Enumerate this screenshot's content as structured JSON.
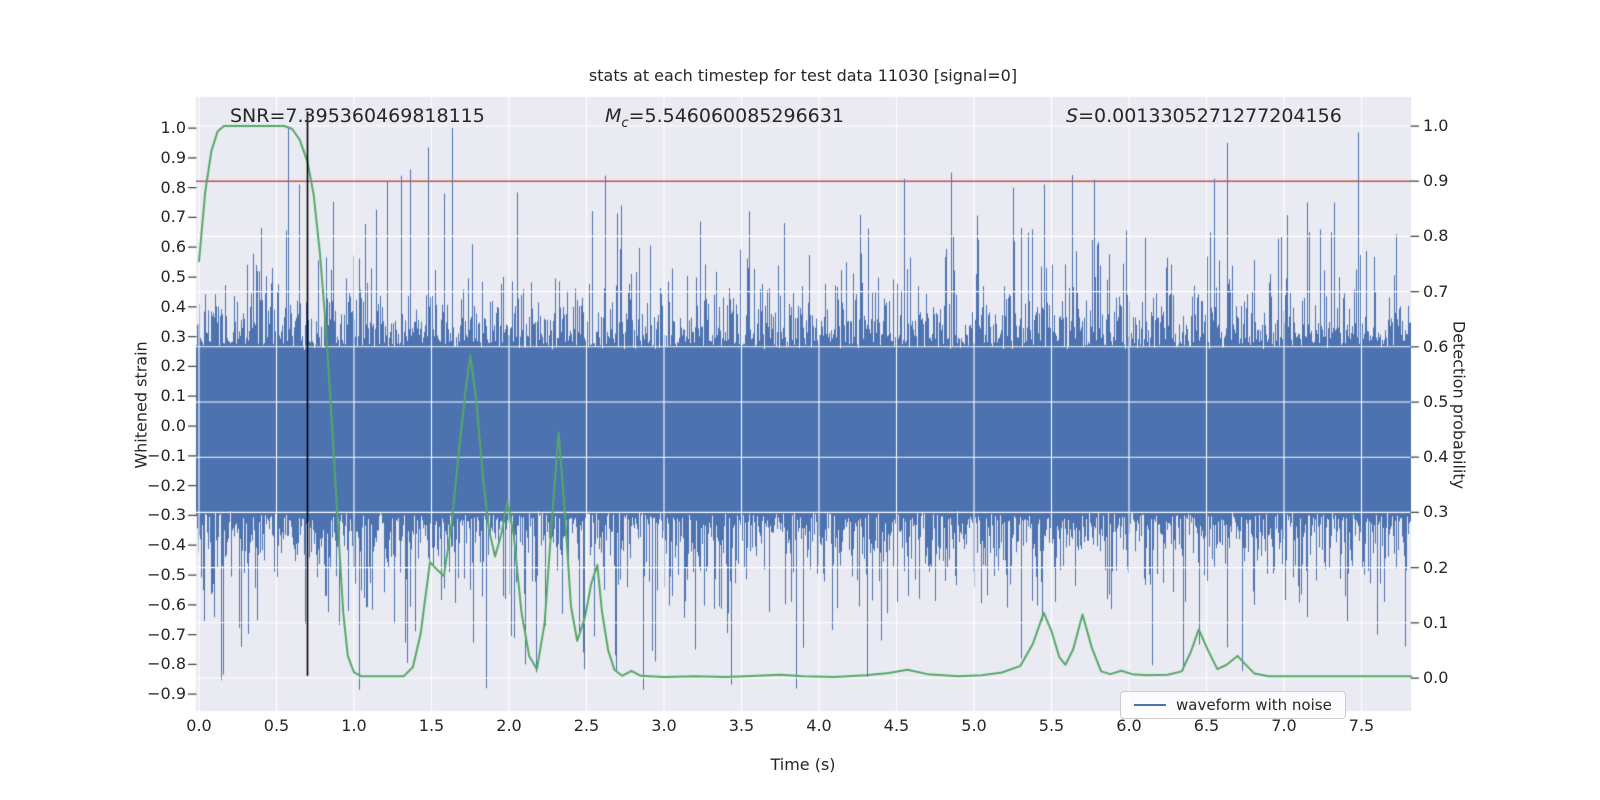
{
  "annotations": {
    "snr": "SNR=7.395360469818115",
    "mc_symbol": "M",
    "mc_subscript": "c",
    "mc_value": "=5.546060085296631",
    "s_symbol": "S",
    "s_value": "=0.0013305271277204156"
  },
  "chart_data": {
    "type": "line",
    "title": "stats at each timestep for test data 11030 [signal=0]",
    "xlabel": "Time (s)",
    "ylabel_left": "Whitened strain",
    "ylabel_right": "Detection probability",
    "xlim": [
      -0.02,
      7.82
    ],
    "ylim_left": [
      -0.95,
      1.1
    ],
    "ylim_right": [
      -0.055,
      1.055
    ],
    "grid": true,
    "colors": {
      "figure_bg": "#ffffff",
      "axes_bg": "#EAEAF2",
      "grid": "#ffffff",
      "text": "#262626",
      "waveform": "#4C72B0",
      "detection": "#55A868",
      "threshold": "#C44E52",
      "marker": "#000000"
    },
    "xticks": [
      {
        "value": 0.0,
        "label": "0.0"
      },
      {
        "value": 0.5,
        "label": "0.5"
      },
      {
        "value": 1.0,
        "label": "1.0"
      },
      {
        "value": 1.5,
        "label": "1.5"
      },
      {
        "value": 2.0,
        "label": "2.0"
      },
      {
        "value": 2.5,
        "label": "2.5"
      },
      {
        "value": 3.0,
        "label": "3.0"
      },
      {
        "value": 3.5,
        "label": "3.5"
      },
      {
        "value": 4.0,
        "label": "4.0"
      },
      {
        "value": 4.5,
        "label": "4.5"
      },
      {
        "value": 5.0,
        "label": "5.0"
      },
      {
        "value": 5.5,
        "label": "5.5"
      },
      {
        "value": 6.0,
        "label": "6.0"
      },
      {
        "value": 6.5,
        "label": "6.5"
      },
      {
        "value": 7.0,
        "label": "7.0"
      },
      {
        "value": 7.5,
        "label": "7.5"
      }
    ],
    "yticks_left": [
      {
        "value": 1.0,
        "label": "1.0"
      },
      {
        "value": 0.9,
        "label": "0.9"
      },
      {
        "value": 0.8,
        "label": "0.8"
      },
      {
        "value": 0.7,
        "label": "0.7"
      },
      {
        "value": 0.6,
        "label": "0.6"
      },
      {
        "value": 0.5,
        "label": "0.5"
      },
      {
        "value": 0.4,
        "label": "0.4"
      },
      {
        "value": 0.3,
        "label": "0.3"
      },
      {
        "value": 0.2,
        "label": "0.2"
      },
      {
        "value": 0.1,
        "label": "0.1"
      },
      {
        "value": 0.0,
        "label": "0.0"
      },
      {
        "value": -0.1,
        "label": "−0.1"
      },
      {
        "value": -0.2,
        "label": "−0.2"
      },
      {
        "value": -0.3,
        "label": "−0.3"
      },
      {
        "value": -0.4,
        "label": "−0.4"
      },
      {
        "value": -0.5,
        "label": "−0.5"
      },
      {
        "value": -0.6,
        "label": "−0.6"
      },
      {
        "value": -0.7,
        "label": "−0.7"
      },
      {
        "value": -0.8,
        "label": "−0.8"
      },
      {
        "value": -0.9,
        "label": "−0.9"
      }
    ],
    "yticks_right": [
      {
        "value": 1.0,
        "label": "1.0"
      },
      {
        "value": 0.9,
        "label": "0.9"
      },
      {
        "value": 0.8,
        "label": "0.8"
      },
      {
        "value": 0.7,
        "label": "0.7"
      },
      {
        "value": 0.6,
        "label": "0.6"
      },
      {
        "value": 0.5,
        "label": "0.5"
      },
      {
        "value": 0.4,
        "label": "0.4"
      },
      {
        "value": 0.3,
        "label": "0.3"
      },
      {
        "value": 0.2,
        "label": "0.2"
      },
      {
        "value": 0.1,
        "label": "0.1"
      },
      {
        "value": 0.0,
        "label": "0.0"
      }
    ],
    "legend": {
      "label": "waveform with noise",
      "loc": "lower right"
    },
    "series": [
      {
        "name": "waveform with noise",
        "type": "noise_envelope",
        "axis": "left",
        "color": "#4C72B0",
        "seed": 7,
        "core_up": 0.255,
        "core_down": 0.285,
        "tail_scale": 0.105,
        "max_up": 1.0,
        "max_down": 0.885,
        "spikes_up": [
          [
            1.3,
            0.84
          ],
          [
            1.36,
            0.86
          ],
          [
            1.58,
            0.78
          ],
          [
            1.63,
            1.0
          ],
          [
            2.62,
            0.84
          ],
          [
            2.72,
            0.74
          ],
          [
            3.55,
            0.72
          ],
          [
            4.55,
            0.83
          ],
          [
            4.85,
            0.85
          ],
          [
            5.25,
            0.8
          ],
          [
            5.45,
            0.81
          ],
          [
            6.55,
            0.83
          ],
          [
            7.15,
            0.75
          ],
          [
            7.3,
            0.65
          ]
        ],
        "spikes_down": [
          [
            1.85,
            0.88
          ],
          [
            2.1,
            0.8
          ],
          [
            2.48,
            0.76
          ],
          [
            3.2,
            0.75
          ],
          [
            4.4,
            0.72
          ],
          [
            5.3,
            0.78
          ],
          [
            6.35,
            0.82
          ],
          [
            7.6,
            0.7
          ]
        ]
      },
      {
        "name": "detection probability",
        "type": "line",
        "axis": "right",
        "color": "#55A868",
        "points": [
          [
            0.0,
            0.755
          ],
          [
            0.04,
            0.88
          ],
          [
            0.08,
            0.955
          ],
          [
            0.12,
            0.99
          ],
          [
            0.16,
            1.0
          ],
          [
            0.55,
            1.0
          ],
          [
            0.6,
            0.995
          ],
          [
            0.65,
            0.975
          ],
          [
            0.7,
            0.935
          ],
          [
            0.74,
            0.875
          ],
          [
            0.78,
            0.77
          ],
          [
            0.82,
            0.63
          ],
          [
            0.86,
            0.45
          ],
          [
            0.9,
            0.26
          ],
          [
            0.93,
            0.12
          ],
          [
            0.96,
            0.04
          ],
          [
            1.0,
            0.01
          ],
          [
            1.05,
            0.003
          ],
          [
            1.32,
            0.003
          ],
          [
            1.38,
            0.02
          ],
          [
            1.43,
            0.08
          ],
          [
            1.49,
            0.21
          ],
          [
            1.54,
            0.195
          ],
          [
            1.58,
            0.185
          ],
          [
            1.63,
            0.28
          ],
          [
            1.68,
            0.42
          ],
          [
            1.72,
            0.52
          ],
          [
            1.75,
            0.585
          ],
          [
            1.79,
            0.5
          ],
          [
            1.83,
            0.37
          ],
          [
            1.87,
            0.27
          ],
          [
            1.91,
            0.22
          ],
          [
            1.95,
            0.26
          ],
          [
            1.99,
            0.32
          ],
          [
            2.03,
            0.26
          ],
          [
            2.08,
            0.12
          ],
          [
            2.13,
            0.04
          ],
          [
            2.18,
            0.016
          ],
          [
            2.23,
            0.1
          ],
          [
            2.27,
            0.26
          ],
          [
            2.32,
            0.445
          ],
          [
            2.36,
            0.3
          ],
          [
            2.4,
            0.13
          ],
          [
            2.44,
            0.067
          ],
          [
            2.49,
            0.11
          ],
          [
            2.53,
            0.17
          ],
          [
            2.57,
            0.205
          ],
          [
            2.6,
            0.12
          ],
          [
            2.64,
            0.05
          ],
          [
            2.68,
            0.015
          ],
          [
            2.73,
            0.004
          ],
          [
            2.79,
            0.013
          ],
          [
            2.85,
            0.004
          ],
          [
            3.0,
            0.002
          ],
          [
            3.2,
            0.003
          ],
          [
            3.4,
            0.002
          ],
          [
            3.6,
            0.004
          ],
          [
            3.75,
            0.006
          ],
          [
            3.9,
            0.003
          ],
          [
            4.1,
            0.002
          ],
          [
            4.3,
            0.005
          ],
          [
            4.45,
            0.009
          ],
          [
            4.57,
            0.015
          ],
          [
            4.7,
            0.007
          ],
          [
            4.9,
            0.003
          ],
          [
            5.05,
            0.005
          ],
          [
            5.18,
            0.01
          ],
          [
            5.3,
            0.022
          ],
          [
            5.38,
            0.062
          ],
          [
            5.45,
            0.118
          ],
          [
            5.5,
            0.085
          ],
          [
            5.55,
            0.038
          ],
          [
            5.59,
            0.024
          ],
          [
            5.64,
            0.052
          ],
          [
            5.7,
            0.115
          ],
          [
            5.76,
            0.055
          ],
          [
            5.82,
            0.012
          ],
          [
            5.88,
            0.007
          ],
          [
            5.95,
            0.013
          ],
          [
            6.02,
            0.007
          ],
          [
            6.12,
            0.005
          ],
          [
            6.25,
            0.006
          ],
          [
            6.34,
            0.012
          ],
          [
            6.4,
            0.048
          ],
          [
            6.45,
            0.088
          ],
          [
            6.51,
            0.05
          ],
          [
            6.57,
            0.016
          ],
          [
            6.63,
            0.024
          ],
          [
            6.7,
            0.04
          ],
          [
            6.76,
            0.022
          ],
          [
            6.81,
            0.008
          ],
          [
            6.9,
            0.003
          ],
          [
            7.1,
            0.003
          ],
          [
            7.3,
            0.003
          ],
          [
            7.5,
            0.003
          ],
          [
            7.82,
            0.003
          ]
        ]
      },
      {
        "name": "detection threshold",
        "type": "hline",
        "axis": "right",
        "color": "#C44E52",
        "y": 0.9
      },
      {
        "name": "event marker",
        "type": "vline",
        "axis": "right",
        "color": "#000000",
        "x": 0.7,
        "ymin": 0.005,
        "ymax": 1.025
      }
    ]
  }
}
